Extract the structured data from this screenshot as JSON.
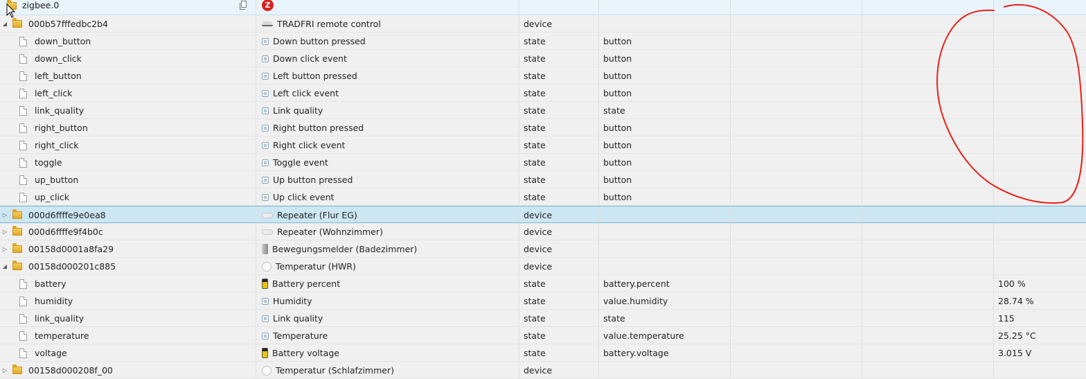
{
  "rows": [
    {
      "kind": "root",
      "id": "zigbee.0",
      "name": "",
      "icon": "zigbee-logo-icon",
      "type": "",
      "role": "",
      "value": ""
    },
    {
      "kind": "folder",
      "open": true,
      "id": "000b57fffedbc2b4",
      "name": "TRADFRI remote control",
      "icon": "remote-control-icon",
      "type": "device",
      "role": "",
      "value": ""
    },
    {
      "kind": "state",
      "id": "down_button",
      "name": "Down button pressed",
      "icon": "state-icon",
      "type": "state",
      "role": "button",
      "value": ""
    },
    {
      "kind": "state",
      "id": "down_click",
      "name": "Down click event",
      "icon": "state-icon",
      "type": "state",
      "role": "button",
      "value": ""
    },
    {
      "kind": "state",
      "id": "left_button",
      "name": "Left button pressed",
      "icon": "state-icon",
      "type": "state",
      "role": "button",
      "value": ""
    },
    {
      "kind": "state",
      "id": "left_click",
      "name": "Left click event",
      "icon": "state-icon",
      "type": "state",
      "role": "button",
      "value": ""
    },
    {
      "kind": "state",
      "id": "link_quality",
      "name": "Link quality",
      "icon": "state-icon",
      "type": "state",
      "role": "state",
      "value": ""
    },
    {
      "kind": "state",
      "id": "right_button",
      "name": "Right button pressed",
      "icon": "state-icon",
      "type": "state",
      "role": "button",
      "value": ""
    },
    {
      "kind": "state",
      "id": "right_click",
      "name": "Right click event",
      "icon": "state-icon",
      "type": "state",
      "role": "button",
      "value": ""
    },
    {
      "kind": "state",
      "id": "toggle",
      "name": "Toggle event",
      "icon": "state-icon",
      "type": "state",
      "role": "button",
      "value": ""
    },
    {
      "kind": "state",
      "id": "up_button",
      "name": "Up button pressed",
      "icon": "state-icon",
      "type": "state",
      "role": "button",
      "value": ""
    },
    {
      "kind": "state",
      "id": "up_click",
      "name": "Up click event",
      "icon": "state-icon",
      "type": "state",
      "role": "button",
      "value": ""
    },
    {
      "kind": "folder",
      "open": false,
      "selected": true,
      "id": "000d6ffffe9e0ea8",
      "name": "Repeater (Flur EG)",
      "icon": "repeater-icon",
      "type": "device",
      "role": "",
      "value": ""
    },
    {
      "kind": "folder",
      "open": false,
      "id": "000d6ffffe9f4b0c",
      "name": "Repeater (Wohnzimmer)",
      "icon": "repeater-icon",
      "type": "device",
      "role": "",
      "value": ""
    },
    {
      "kind": "folder",
      "open": false,
      "id": "00158d0001a8fa29",
      "name": "Bewegungsmelder (Badezimmer)",
      "icon": "motion-sensor-icon",
      "type": "device",
      "role": "",
      "value": ""
    },
    {
      "kind": "folder",
      "open": true,
      "id": "00158d000201c885",
      "name": "Temperatur (HWR)",
      "icon": "temperature-sensor-icon",
      "type": "device",
      "role": "",
      "value": ""
    },
    {
      "kind": "state",
      "id": "battery",
      "name": "Battery percent",
      "icon": "battery-icon",
      "type": "state",
      "role": "battery.percent",
      "value": "100 %"
    },
    {
      "kind": "state",
      "id": "humidity",
      "name": "Humidity",
      "icon": "state-icon",
      "type": "state",
      "role": "value.humidity",
      "value": "28.74 %"
    },
    {
      "kind": "state",
      "id": "link_quality",
      "name": "Link quality",
      "icon": "state-icon",
      "type": "state",
      "role": "state",
      "value": "115"
    },
    {
      "kind": "state",
      "id": "temperature",
      "name": "Temperature",
      "icon": "state-icon",
      "type": "state",
      "role": "value.temperature",
      "value": "25.25 °C"
    },
    {
      "kind": "state",
      "id": "voltage",
      "name": "Battery voltage",
      "icon": "battery-icon",
      "type": "state",
      "role": "battery.voltage",
      "value": "3.015 V"
    },
    {
      "kind": "folder",
      "open": false,
      "partial": true,
      "id": "00158d000208f_00",
      "name": "Temperatur (Schlafzimmer)",
      "icon": "temperature-sensor-icon",
      "type": "device",
      "role": "",
      "value": ""
    }
  ],
  "annotation": {
    "shape": "hand-drawn-circle",
    "color": "#e8211a"
  }
}
